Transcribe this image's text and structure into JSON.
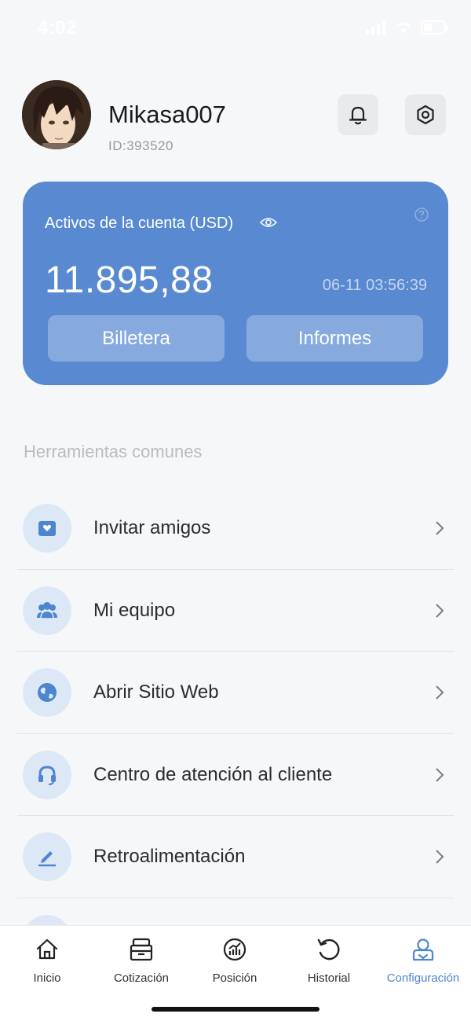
{
  "status_bar": {
    "time": "4:02"
  },
  "profile": {
    "username": "Mikasa007",
    "user_id": "ID:393520"
  },
  "asset_card": {
    "label": "Activos de la cuenta (USD)",
    "value": "11.895,88",
    "timestamp": "06-11 03:56:39",
    "wallet_label": "Billetera",
    "reports_label": "Informes",
    "color": "#5889d1"
  },
  "tools": {
    "title": "Herramientas comunes",
    "items": [
      {
        "label": "Invitar amigos",
        "icon": "invite-icon"
      },
      {
        "label": "Mi equipo",
        "icon": "team-icon"
      },
      {
        "label": "Abrir Sitio Web",
        "icon": "globe-icon"
      },
      {
        "label": "Centro de atención al cliente",
        "icon": "headset-icon"
      },
      {
        "label": "Retroalimentación",
        "icon": "edit-icon"
      }
    ]
  },
  "tab_bar": {
    "active_color": "#4d85cf",
    "tabs": [
      {
        "label": "Inicio",
        "icon": "home-icon"
      },
      {
        "label": "Cotización",
        "icon": "quote-icon"
      },
      {
        "label": "Posición",
        "icon": "position-icon"
      },
      {
        "label": "Historial",
        "icon": "history-icon"
      },
      {
        "label": "Configuración",
        "icon": "profile-icon",
        "active": true
      }
    ]
  }
}
